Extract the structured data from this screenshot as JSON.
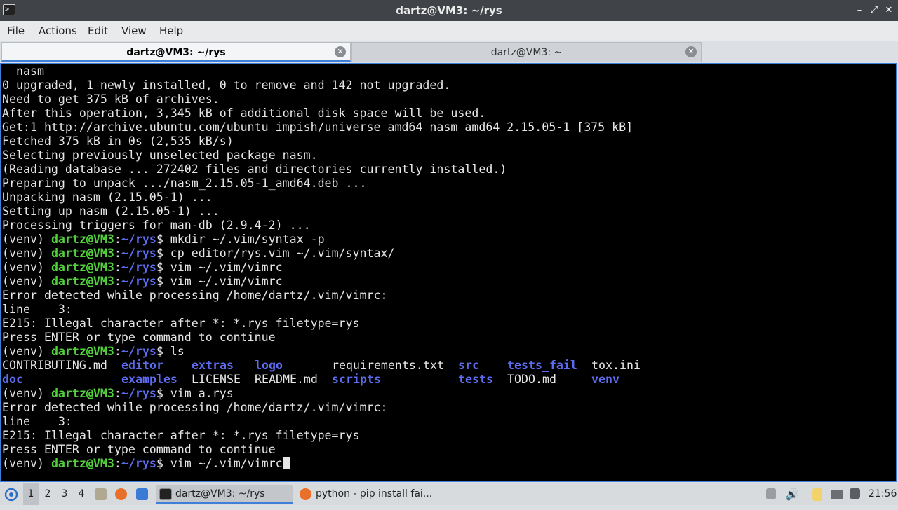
{
  "window": {
    "title": "dartz@VM3: ~/rys",
    "controls": [
      "–",
      "⤢",
      "✕"
    ]
  },
  "menu": [
    "File",
    "Actions",
    "Edit",
    "View",
    "Help"
  ],
  "tabs": [
    {
      "label": "dartz@VM3: ~/rys",
      "active": true
    },
    {
      "label": "dartz@VM3: ~",
      "active": false
    }
  ],
  "terminal": {
    "lines": [
      [
        [
          "w",
          "  nasm"
        ]
      ],
      [
        [
          "w",
          "0 upgraded, 1 newly installed, 0 to remove and 142 not upgraded."
        ]
      ],
      [
        [
          "w",
          "Need to get 375 kB of archives."
        ]
      ],
      [
        [
          "w",
          "After this operation, 3,345 kB of additional disk space will be used."
        ]
      ],
      [
        [
          "w",
          "Get:1 http://archive.ubuntu.com/ubuntu impish/universe amd64 nasm amd64 2.15.05-1 [375 kB]"
        ]
      ],
      [
        [
          "w",
          "Fetched 375 kB in 0s (2,535 kB/s)"
        ]
      ],
      [
        [
          "w",
          "Selecting previously unselected package nasm."
        ]
      ],
      [
        [
          "w",
          "(Reading database ... 272402 files and directories currently installed.)"
        ]
      ],
      [
        [
          "w",
          "Preparing to unpack .../nasm_2.15.05-1_amd64.deb ..."
        ]
      ],
      [
        [
          "w",
          "Unpacking nasm (2.15.05-1) ..."
        ]
      ],
      [
        [
          "w",
          "Setting up nasm (2.15.05-1) ..."
        ]
      ],
      [
        [
          "w",
          "Processing triggers for man-db (2.9.4-2) ..."
        ]
      ],
      [
        [
          "w",
          "(venv) "
        ],
        [
          "g",
          "dartz@VM3"
        ],
        [
          "w",
          ":"
        ],
        [
          "b",
          "~/rys"
        ],
        [
          "w",
          "$ mkdir ~/.vim/syntax -p"
        ]
      ],
      [
        [
          "w",
          "(venv) "
        ],
        [
          "g",
          "dartz@VM3"
        ],
        [
          "w",
          ":"
        ],
        [
          "b",
          "~/rys"
        ],
        [
          "w",
          "$ cp editor/rys.vim ~/.vim/syntax/"
        ]
      ],
      [
        [
          "w",
          "(venv) "
        ],
        [
          "g",
          "dartz@VM3"
        ],
        [
          "w",
          ":"
        ],
        [
          "b",
          "~/rys"
        ],
        [
          "w",
          "$ vim ~/.vim/vimrc"
        ]
      ],
      [
        [
          "w",
          "(venv) "
        ],
        [
          "g",
          "dartz@VM3"
        ],
        [
          "w",
          ":"
        ],
        [
          "b",
          "~/rys"
        ],
        [
          "w",
          "$ vim ~/.vim/vimrc"
        ]
      ],
      [
        [
          "w",
          "Error detected while processing /home/dartz/.vim/vimrc:"
        ]
      ],
      [
        [
          "w",
          "line    3:"
        ]
      ],
      [
        [
          "w",
          "E215: Illegal character after *: *.rys filetype=rys"
        ]
      ],
      [
        [
          "w",
          "Press ENTER or type command to continue"
        ]
      ],
      [
        [
          "w",
          "(venv) "
        ],
        [
          "g",
          "dartz@VM3"
        ],
        [
          "w",
          ":"
        ],
        [
          "b",
          "~/rys"
        ],
        [
          "w",
          "$ ls"
        ]
      ],
      "LS1",
      "LS2",
      [
        [
          "w",
          "(venv) "
        ],
        [
          "g",
          "dartz@VM3"
        ],
        [
          "w",
          ":"
        ],
        [
          "b",
          "~/rys"
        ],
        [
          "w",
          "$ vim a.rys"
        ]
      ],
      [
        [
          "w",
          "Error detected while processing /home/dartz/.vim/vimrc:"
        ]
      ],
      [
        [
          "w",
          "line    3:"
        ]
      ],
      [
        [
          "w",
          "E215: Illegal character after *: *.rys filetype=rys"
        ]
      ],
      [
        [
          "w",
          "Press ENTER or type command to continue"
        ]
      ],
      "PROMPT"
    ],
    "ls_row1": [
      {
        "t": "CONTRIBUTING.md",
        "c": "w",
        "col": 0
      },
      {
        "t": "editor",
        "c": "b",
        "col": 17
      },
      {
        "t": "extras",
        "c": "b",
        "col": 27
      },
      {
        "t": "logo",
        "c": "b",
        "col": 36
      },
      {
        "t": "requirements.txt",
        "c": "w",
        "col": 47
      },
      {
        "t": "src",
        "c": "b",
        "col": 65
      },
      {
        "t": "tests_fail",
        "c": "b",
        "col": 72
      },
      {
        "t": "tox.ini",
        "c": "w",
        "col": 84
      }
    ],
    "ls_row2": [
      {
        "t": "doc",
        "c": "b",
        "col": 0
      },
      {
        "t": "examples",
        "c": "b",
        "col": 17
      },
      {
        "t": "LICENSE",
        "c": "w",
        "col": 27
      },
      {
        "t": "README.md",
        "c": "w",
        "col": 36
      },
      {
        "t": "scripts",
        "c": "b",
        "col": 47
      },
      {
        "t": "tests",
        "c": "b",
        "col": 65
      },
      {
        "t": "TODO.md",
        "c": "w",
        "col": 72
      },
      {
        "t": "venv",
        "c": "b",
        "col": 84
      }
    ],
    "prompt": {
      "venv": "(venv) ",
      "user_host": "dartz@VM3",
      "sep": ":",
      "path": "~/rys",
      "command": "$ vim ~/.vim/vimrc"
    }
  },
  "taskbar": {
    "workspaces": [
      "1",
      "2",
      "3",
      "4"
    ],
    "active_workspace": "1",
    "tasks": [
      {
        "label": "dartz@VM3: ~/rys",
        "icon": "terminal-icon",
        "active": true
      },
      {
        "label": "python - pip install fai...",
        "icon": "firefox-icon",
        "active": false
      }
    ],
    "clock": "21:56"
  }
}
